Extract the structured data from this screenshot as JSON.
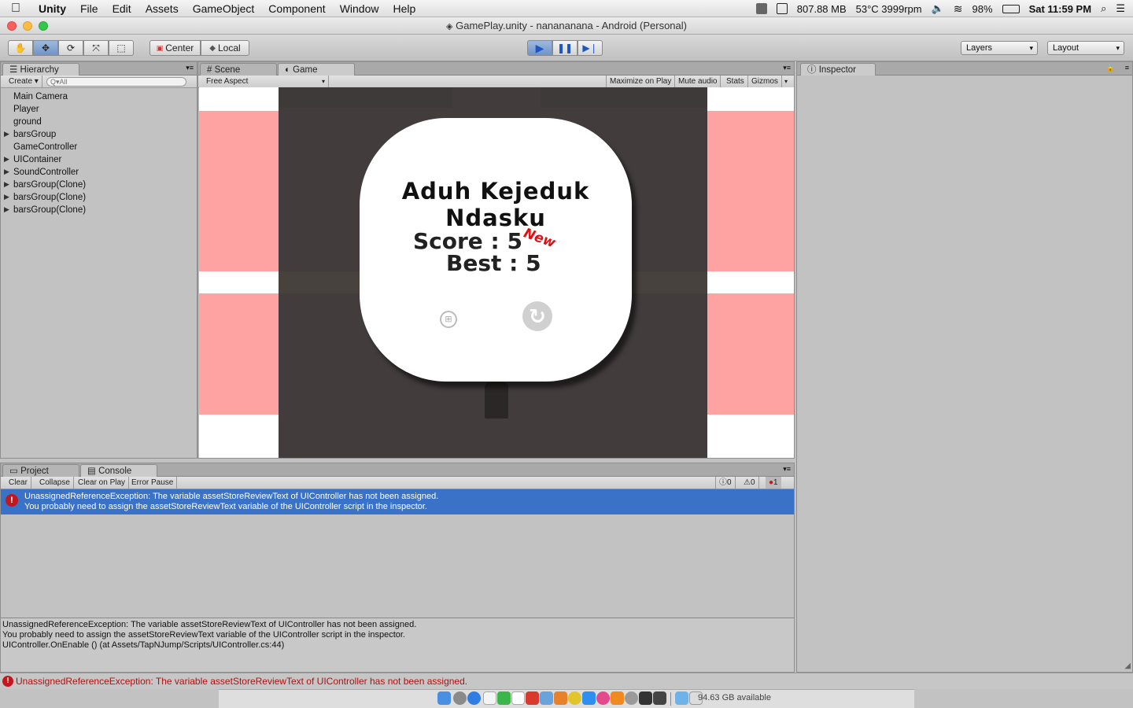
{
  "menubar": {
    "app": "Unity",
    "items": [
      "File",
      "Edit",
      "Assets",
      "GameObject",
      "Component",
      "Window",
      "Help"
    ],
    "memory": "807.88 MB",
    "temp_fan": "53°C 3999rpm",
    "battery": "98%",
    "clock": "Sat 11:59 PM"
  },
  "window": {
    "title": "GamePlay.unity - nanananana - Android (Personal)"
  },
  "toolbar": {
    "pivot_label": "Center",
    "space_label": "Local",
    "layers_label": "Layers",
    "layout_label": "Layout"
  },
  "hierarchy": {
    "tab": "Hierarchy",
    "create_label": "Create",
    "search_placeholder": "Q▾All",
    "items": [
      {
        "label": "Main Camera",
        "expandable": false
      },
      {
        "label": "Player",
        "expandable": false
      },
      {
        "label": "ground",
        "expandable": false
      },
      {
        "label": "barsGroup",
        "expandable": true
      },
      {
        "label": "GameController",
        "expandable": false
      },
      {
        "label": "UIContainer",
        "expandable": true
      },
      {
        "label": "SoundController",
        "expandable": true
      },
      {
        "label": "barsGroup(Clone)",
        "expandable": true
      },
      {
        "label": "barsGroup(Clone)",
        "expandable": true
      },
      {
        "label": "barsGroup(Clone)",
        "expandable": true
      }
    ]
  },
  "center_tabs": {
    "scene": "Scene",
    "game": "Game"
  },
  "game_bar": {
    "aspect": "Free Aspect",
    "maximize": "Maximize on Play",
    "mute": "Mute audio",
    "stats": "Stats",
    "gizmos": "Gizmos"
  },
  "game": {
    "title": "Aduh Kejeduk Ndasku",
    "score_label": "Score : 5",
    "new_tag": "New",
    "best_label": "Best : 5"
  },
  "inspector": {
    "tab": "Inspector"
  },
  "bottom_tabs": {
    "project": "Project",
    "console": "Console"
  },
  "console": {
    "buttons": [
      "Clear",
      "Collapse",
      "Clear on Play",
      "Error Pause"
    ],
    "counts": {
      "info": "0",
      "warn": "0",
      "error": "1"
    },
    "selected_entry": {
      "line1": "UnassignedReferenceException: The variable assetStoreReviewText of UIController has not been assigned.",
      "line2": "You probably need to assign the assetStoreReviewText variable of the UIController script in the inspector."
    },
    "detail": [
      "UnassignedReferenceException: The variable assetStoreReviewText of UIController has not been assigned.",
      "You probably need to assign the assetStoreReviewText variable of the UIController script in the inspector.",
      "UIController.OnEnable () (at Assets/TapNJump/Scripts/UIController.cs:44)"
    ]
  },
  "statusbar": {
    "message": "UnassignedReferenceException: The variable assetStoreReviewText of UIController has not been assigned."
  },
  "dock": {
    "disk": "94.63 GB available"
  }
}
